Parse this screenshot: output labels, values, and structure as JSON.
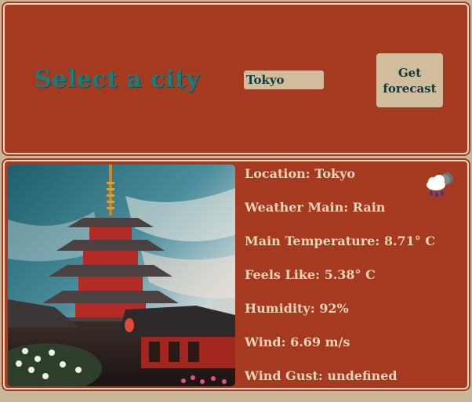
{
  "header": {
    "title": "Select a city",
    "city_input_value": "Tokyo",
    "get_button_label": "Get forecast"
  },
  "weather": {
    "icon": "rain-cloud-icon",
    "rows": [
      "Location: Tokyo",
      "Weather Main: Rain",
      "Main Temperature: 8.71° C",
      "Feels Like: 5.38° C",
      "Humidity: 92%",
      "Wind: 6.69 m/s",
      "Wind Gust: undefined"
    ]
  },
  "colors": {
    "panel_bg": "#a53a21",
    "title_teal": "#1f7b78",
    "input_bg": "#d1bc9b",
    "text_cream": "#e9d4b6"
  }
}
